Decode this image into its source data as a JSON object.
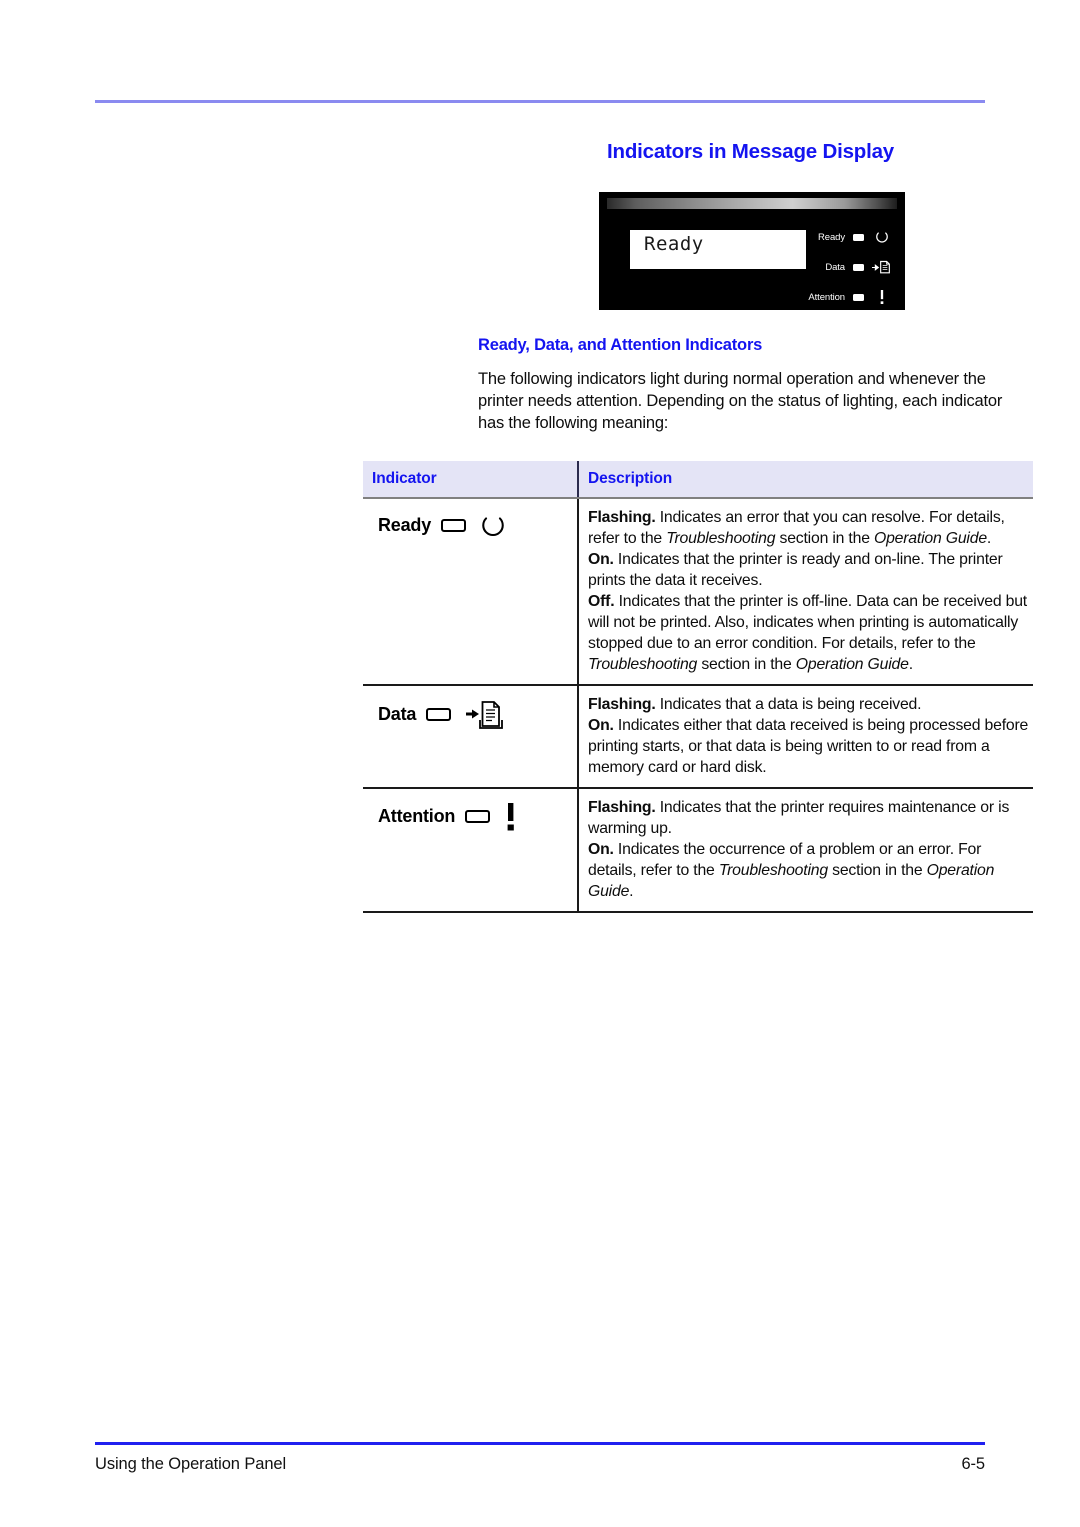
{
  "document": {
    "section_title": "Indicators in Message Display",
    "subsection_title": "Ready, Data, and Attention Indicators",
    "intro_paragraph": "The following indicators light during normal operation and whenever the printer needs attention. Depending on the status of lighting, each indicator has the following meaning:"
  },
  "panel": {
    "lcd_message": "Ready",
    "leds": [
      {
        "label": "Ready",
        "glyph": "power-standby-icon"
      },
      {
        "label": "Data",
        "glyph": "data-receive-icon"
      },
      {
        "label": "Attention",
        "glyph": "exclamation-icon"
      }
    ]
  },
  "table": {
    "headers": {
      "indicator": "Indicator",
      "description": "Description"
    },
    "rows": [
      {
        "name": "Ready",
        "lamp": "led-lamp-icon",
        "glyph": "power-standby-icon",
        "lines": [
          {
            "state": "Flashing.",
            "text": " Indicates an error that you can resolve. For details, refer to the ",
            "italic": "Troubleshooting",
            "text2": " section in the ",
            "italic2": "Operation Guide",
            "text3": "."
          },
          {
            "state": "On.",
            "text": " Indicates that the printer is ready and on-line. The printer prints the data it receives.",
            "italic": "",
            "text2": "",
            "italic2": "",
            "text3": ""
          },
          {
            "state": "Off.",
            "text": " Indicates that the printer is off-line. Data can be received but will not be printed. Also, indicates when printing is automatically stopped due to an error condition. For details, refer to the ",
            "italic": "Troubleshooting",
            "text2": " section in the ",
            "italic2": "Operation Guide",
            "text3": "."
          }
        ]
      },
      {
        "name": "Data",
        "lamp": "led-lamp-icon",
        "glyph": "data-receive-icon",
        "lines": [
          {
            "state": "Flashing.",
            "text": " Indicates that a data is being received.",
            "italic": "",
            "text2": "",
            "italic2": "",
            "text3": ""
          },
          {
            "state": "On.",
            "text": " Indicates either that data received is being processed before printing starts, or that data is being written to or read from a memory card or hard disk.",
            "italic": "",
            "text2": "",
            "italic2": "",
            "text3": ""
          }
        ]
      },
      {
        "name": "Attention",
        "lamp": "led-lamp-icon",
        "glyph": "exclamation-icon",
        "lines": [
          {
            "state": "Flashing.",
            "text": " Indicates that the printer requires maintenance or is warming up.",
            "italic": "",
            "text2": "",
            "italic2": "",
            "text3": ""
          },
          {
            "state": "On.",
            "text": " Indicates the occurrence of a problem or an error. For details, refer to the ",
            "italic": "Troubleshooting",
            "text2": " section in the ",
            "italic2": "Operation Guide",
            "text3": "."
          }
        ]
      }
    ]
  },
  "footer": {
    "left": "Using the Operation Panel",
    "right": "6-5"
  },
  "colors": {
    "heading_blue": "#1414F0",
    "header_rule": "#8A8AF0",
    "footer_rule": "#2020F0",
    "table_header_bg": "#E4E4F6"
  }
}
